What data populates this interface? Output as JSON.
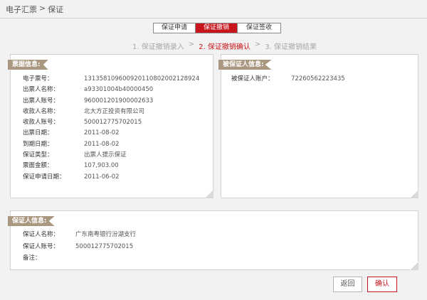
{
  "breadcrumb": {
    "parent": "电子汇票",
    "separator": ">",
    "current": "保证"
  },
  "tabs": [
    {
      "label": "保证申请",
      "active": false
    },
    {
      "label": "保证撤销",
      "active": true
    },
    {
      "label": "保证签收",
      "active": false
    }
  ],
  "steps": {
    "step1": "1. 保证撤销录入",
    "sep1": ">",
    "step2": "2. 保证撤销确认",
    "sep2": ">",
    "step3": "3. 保证撤销结果",
    "active_step": 2
  },
  "bill_info": {
    "title": "票据信息:",
    "fields": [
      {
        "label": "电子票号：",
        "value": "131358109600920110802002128924"
      },
      {
        "label": "出票人名称：",
        "value": "a93301004b40000450"
      },
      {
        "label": "出票人账号：",
        "value": "960001201900002633"
      },
      {
        "label": "收款人名称：",
        "value": "北大方正投资有限公司"
      },
      {
        "label": "收款人账号：",
        "value": "500012775702015"
      },
      {
        "label": "出票日期：",
        "value": "2011-08-02"
      },
      {
        "label": "到期日期：",
        "value": "2011-08-02"
      },
      {
        "label": "保证类型：",
        "value": "出票人提示保证"
      },
      {
        "label": "票面金额：",
        "value": "107,903.00"
      },
      {
        "label": "保证申请日期：",
        "value": "2011-06-02"
      }
    ]
  },
  "guaranteed_info": {
    "title": "被保证人信息:",
    "fields": [
      {
        "label": "被保证人账户：",
        "value": "72260562223435"
      }
    ]
  },
  "guarantor_info": {
    "title": "保证人信息:",
    "fields": [
      {
        "label": "保证人名称：",
        "value": "广东南粤银行汾湖支行"
      },
      {
        "label": "保证人账号：",
        "value": "500012775702015"
      },
      {
        "label": "备注：",
        "value": ""
      }
    ]
  },
  "buttons": {
    "back": "返回",
    "confirm": "确认"
  },
  "colors": {
    "accent": "#c8151b",
    "ribbon": "#a9987f",
    "background": "#f2f2f2"
  }
}
